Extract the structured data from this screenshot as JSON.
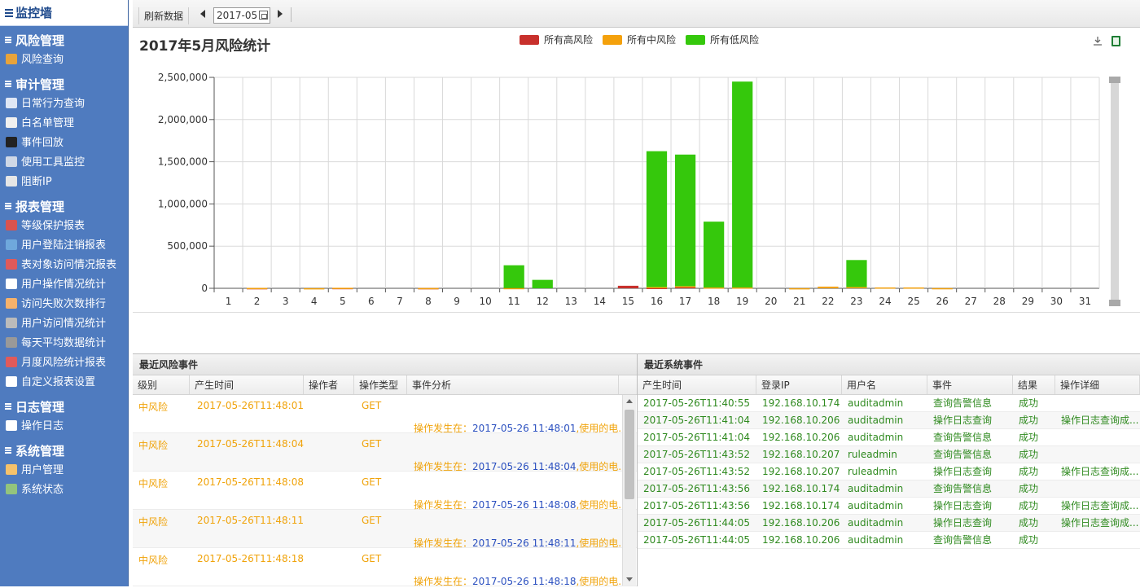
{
  "sidebar": {
    "home": "监控墙",
    "groups": [
      {
        "title": "风险管理",
        "items": [
          {
            "label": "风险查询",
            "icon": "report-icon"
          }
        ]
      },
      {
        "title": "审计管理",
        "items": [
          {
            "label": "日常行为查询",
            "icon": "search-icon"
          },
          {
            "label": "白名单管理",
            "icon": "pages-icon"
          },
          {
            "label": "事件回放",
            "icon": "terminal-icon"
          },
          {
            "label": "使用工具监控",
            "icon": "monitor-icon"
          },
          {
            "label": "阻断IP",
            "icon": "tag-icon"
          }
        ]
      },
      {
        "title": "报表管理",
        "items": [
          {
            "label": "等级保护报表",
            "icon": "bar-chart-icon"
          },
          {
            "label": "用户登陆注销报表",
            "icon": "line-chart-icon"
          },
          {
            "label": "表对象访问情况报表",
            "icon": "trend-icon"
          },
          {
            "label": "用户操作情况统计",
            "icon": "stats-icon"
          },
          {
            "label": "访问失败次数排行",
            "icon": "warning-doc-icon"
          },
          {
            "label": "用户访问情况统计",
            "icon": "db-stats-icon"
          },
          {
            "label": "每天平均数据统计",
            "icon": "db-avg-icon"
          },
          {
            "label": "月度风险统计报表",
            "icon": "trend-icon"
          },
          {
            "label": "自定义报表设置",
            "icon": "edit-report-icon"
          }
        ]
      },
      {
        "title": "日志管理",
        "items": [
          {
            "label": "操作日志",
            "icon": "log-icon"
          }
        ]
      },
      {
        "title": "系统管理",
        "items": [
          {
            "label": "用户管理",
            "icon": "user-icon"
          },
          {
            "label": "系统状态",
            "icon": "status-icon"
          }
        ]
      }
    ]
  },
  "toolbar": {
    "refresh_label": "刷新数据",
    "month_value": "2017-05"
  },
  "chart": {
    "title": "2017年5月风险统计"
  },
  "chart_data": {
    "type": "bar",
    "title": "2017年5月风险统计",
    "xlabel": "",
    "ylabel": "",
    "categories": [
      "1",
      "2",
      "3",
      "4",
      "5",
      "6",
      "7",
      "8",
      "9",
      "10",
      "11",
      "12",
      "13",
      "14",
      "15",
      "16",
      "17",
      "18",
      "19",
      "20",
      "21",
      "22",
      "23",
      "24",
      "25",
      "26",
      "27",
      "28",
      "29",
      "30",
      "31"
    ],
    "ylim": [
      0,
      2500000
    ],
    "yticks": [
      "0",
      "500,000",
      "1,000,000",
      "1,500,000",
      "2,000,000",
      "2,500,000"
    ],
    "ytick_values": [
      0,
      500000,
      1000000,
      1500000,
      2000000,
      2500000
    ],
    "legend_position": "top",
    "grid": true,
    "stacked": true,
    "series": [
      {
        "name": "所有高风险",
        "color": "#c8302c",
        "values": [
          0,
          2000,
          0,
          0,
          3000,
          0,
          0,
          2000,
          0,
          0,
          0,
          0,
          0,
          0,
          30000,
          5000,
          15000,
          0,
          0,
          0,
          0,
          0,
          0,
          0,
          0,
          0,
          0,
          0,
          0,
          0,
          0
        ]
      },
      {
        "name": "所有中风险",
        "color": "#f4a10c",
        "values": [
          0,
          2000,
          0,
          1000,
          3000,
          0,
          0,
          1000,
          0,
          0,
          3000,
          0,
          0,
          0,
          0,
          10000,
          10000,
          10000,
          10000,
          0,
          1000,
          20000,
          15000,
          10000,
          10000,
          2000,
          0,
          0,
          0,
          0,
          0
        ]
      },
      {
        "name": "所有低风险",
        "color": "#35c80c",
        "values": [
          0,
          0,
          0,
          0,
          0,
          0,
          0,
          0,
          0,
          0,
          270000,
          100000,
          0,
          0,
          0,
          1610000,
          1560000,
          780000,
          2440000,
          0,
          0,
          0,
          320000,
          0,
          0,
          0,
          0,
          0,
          0,
          0,
          0
        ]
      }
    ]
  },
  "risk_panel": {
    "title": "最近风险事件",
    "columns": [
      "级别",
      "产生时间",
      "操作者",
      "操作类型",
      "事件分析"
    ],
    "rows": [
      {
        "level": "中风险",
        "time": "2017-05-26T11:48:01",
        "op": "GET",
        "prefix": "操作发生在：",
        "dt": "2017-05-26 11:48:01",
        "suffix": ",使用的电..."
      },
      {
        "level": "中风险",
        "time": "2017-05-26T11:48:04",
        "op": "GET",
        "prefix": "操作发生在：",
        "dt": "2017-05-26 11:48:04",
        "suffix": ",使用的电..."
      },
      {
        "level": "中风险",
        "time": "2017-05-26T11:48:08",
        "op": "GET",
        "prefix": "操作发生在：",
        "dt": "2017-05-26 11:48:08",
        "suffix": ",使用的电..."
      },
      {
        "level": "中风险",
        "time": "2017-05-26T11:48:11",
        "op": "GET",
        "prefix": "操作发生在：",
        "dt": "2017-05-26 11:48:11",
        "suffix": ",使用的电..."
      },
      {
        "level": "中风险",
        "time": "2017-05-26T11:48:18",
        "op": "GET",
        "prefix": "操作发生在：",
        "dt": "2017-05-26 11:48:18",
        "suffix": ",使用的电..."
      }
    ]
  },
  "sys_panel": {
    "title": "最近系统事件",
    "columns": [
      "产生时间",
      "登录IP",
      "用户名",
      "事件",
      "结果",
      "操作详细"
    ],
    "rows": [
      {
        "time": "2017-05-26T11:40:55",
        "ip": "192.168.10.174",
        "user": "auditadmin",
        "event": "查询告警信息",
        "result": "成功",
        "detail": ""
      },
      {
        "time": "2017-05-26T11:41:04",
        "ip": "192.168.10.206",
        "user": "auditadmin",
        "event": "操作日志查询",
        "result": "成功",
        "detail": "操作日志查询成..."
      },
      {
        "time": "2017-05-26T11:41:04",
        "ip": "192.168.10.206",
        "user": "auditadmin",
        "event": "查询告警信息",
        "result": "成功",
        "detail": ""
      },
      {
        "time": "2017-05-26T11:43:52",
        "ip": "192.168.10.207",
        "user": "ruleadmin",
        "event": "查询告警信息",
        "result": "成功",
        "detail": ""
      },
      {
        "time": "2017-05-26T11:43:52",
        "ip": "192.168.10.207",
        "user": "ruleadmin",
        "event": "操作日志查询",
        "result": "成功",
        "detail": "操作日志查询成..."
      },
      {
        "time": "2017-05-26T11:43:56",
        "ip": "192.168.10.174",
        "user": "auditadmin",
        "event": "查询告警信息",
        "result": "成功",
        "detail": ""
      },
      {
        "time": "2017-05-26T11:43:56",
        "ip": "192.168.10.174",
        "user": "auditadmin",
        "event": "操作日志查询",
        "result": "成功",
        "detail": "操作日志查询成..."
      },
      {
        "time": "2017-05-26T11:44:05",
        "ip": "192.168.10.206",
        "user": "auditadmin",
        "event": "操作日志查询",
        "result": "成功",
        "detail": "操作日志查询成..."
      },
      {
        "time": "2017-05-26T11:44:05",
        "ip": "192.168.10.206",
        "user": "auditadmin",
        "event": "查询告警信息",
        "result": "成功",
        "detail": ""
      }
    ]
  }
}
